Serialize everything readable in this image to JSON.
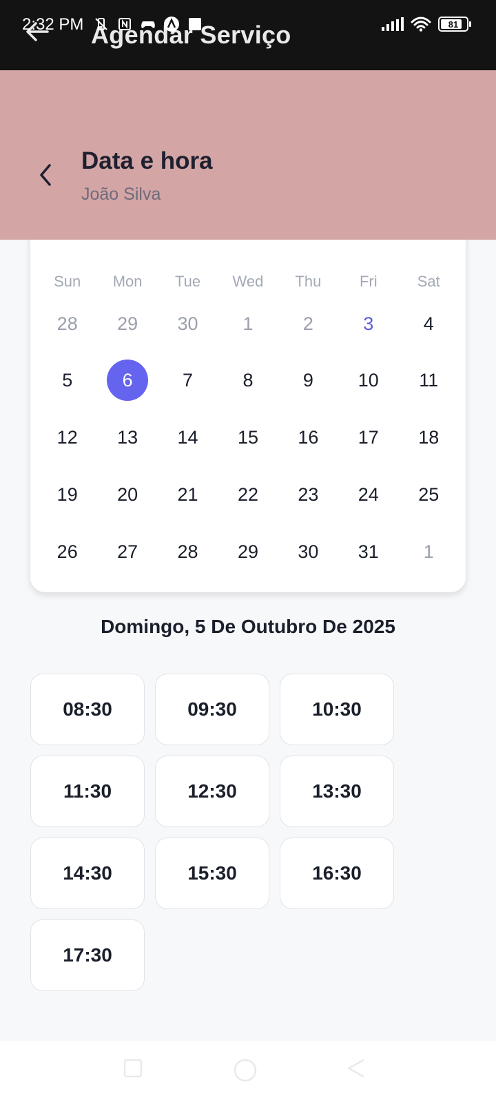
{
  "status_bar": {
    "time": "2:32 PM",
    "battery": "81"
  },
  "app_bar": {
    "title": "Agendar Serviço"
  },
  "header": {
    "title": "Data e hora",
    "subtitle": "João Silva",
    "background": "#d4a5a5"
  },
  "calendar": {
    "weekdays": [
      "Sun",
      "Mon",
      "Tue",
      "Wed",
      "Thu",
      "Fri",
      "Sat"
    ],
    "weeks": [
      [
        {
          "d": "28",
          "s": "muted"
        },
        {
          "d": "29",
          "s": "muted"
        },
        {
          "d": "30",
          "s": "muted"
        },
        {
          "d": "1",
          "s": "muted"
        },
        {
          "d": "2",
          "s": "muted"
        },
        {
          "d": "3",
          "s": "today"
        },
        {
          "d": "4",
          "s": ""
        }
      ],
      [
        {
          "d": "5",
          "s": ""
        },
        {
          "d": "6",
          "s": "selected"
        },
        {
          "d": "7",
          "s": ""
        },
        {
          "d": "8",
          "s": ""
        },
        {
          "d": "9",
          "s": ""
        },
        {
          "d": "10",
          "s": ""
        },
        {
          "d": "11",
          "s": ""
        }
      ],
      [
        {
          "d": "12",
          "s": ""
        },
        {
          "d": "13",
          "s": ""
        },
        {
          "d": "14",
          "s": ""
        },
        {
          "d": "15",
          "s": ""
        },
        {
          "d": "16",
          "s": ""
        },
        {
          "d": "17",
          "s": ""
        },
        {
          "d": "18",
          "s": ""
        }
      ],
      [
        {
          "d": "19",
          "s": ""
        },
        {
          "d": "20",
          "s": ""
        },
        {
          "d": "21",
          "s": ""
        },
        {
          "d": "22",
          "s": ""
        },
        {
          "d": "23",
          "s": ""
        },
        {
          "d": "24",
          "s": ""
        },
        {
          "d": "25",
          "s": ""
        }
      ],
      [
        {
          "d": "26",
          "s": ""
        },
        {
          "d": "27",
          "s": ""
        },
        {
          "d": "28",
          "s": ""
        },
        {
          "d": "29",
          "s": ""
        },
        {
          "d": "30",
          "s": ""
        },
        {
          "d": "31",
          "s": ""
        },
        {
          "d": "1",
          "s": "muted"
        }
      ]
    ],
    "accent": "#6464ef"
  },
  "selected_date_label": "Domingo, 5 De Outubro De 2025",
  "time_slots": [
    "08:30",
    "09:30",
    "10:30",
    "11:30",
    "12:30",
    "13:30",
    "14:30",
    "15:30",
    "16:30",
    "17:30"
  ]
}
